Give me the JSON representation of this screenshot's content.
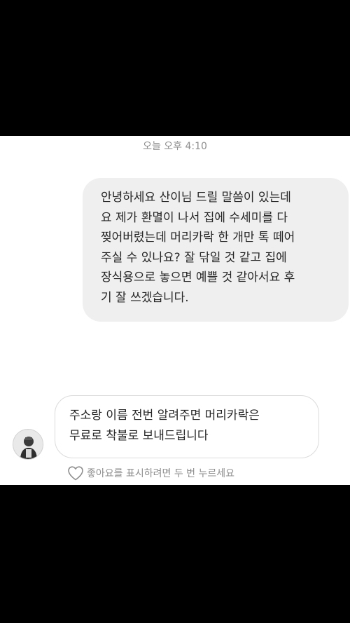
{
  "conversation": {
    "timestamp": "오늘 오후 4:10",
    "sent_message": {
      "lines": [
        "안녕하세요 산이님 드릴 말씀이 있는데",
        "요 제가 환멸이 나서 집에 수세미를 다",
        "찢어버렸는데 머리카락 한 개만 톡 떼어",
        "주실 수 있나요? 잘 닦일 것 같고 집에",
        "장식용으로 놓으면 예쁠 것 같아서요 후",
        "기 잘 쓰겠습니다."
      ]
    },
    "received_message": {
      "lines": [
        "주소랑 이름 전번 알려주면 머리카락은",
        "무료로 착불로 보내드립니다"
      ]
    },
    "like_hint": "좋아요를 표시하려면 두 번 누르세요"
  },
  "colors": {
    "sent_bubble": "#efefef",
    "received_border": "#dbdbdb",
    "text": "#262626",
    "meta_text": "#8e8e8e"
  },
  "icons": {
    "like": "heart-outline-icon",
    "avatar": "user-avatar"
  }
}
